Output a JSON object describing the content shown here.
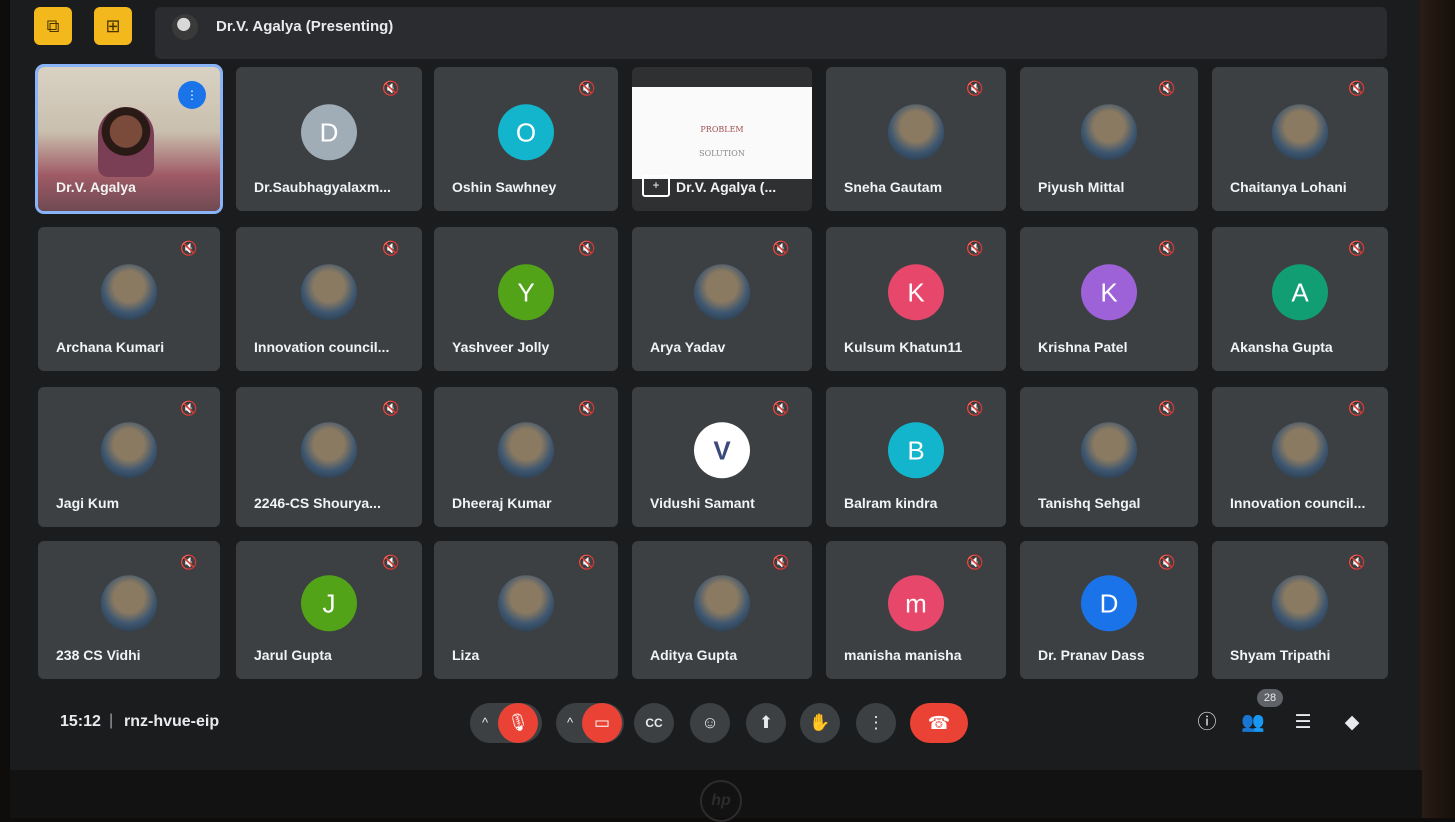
{
  "header": {
    "presenting_label": "Dr.V. Agalya (Presenting)",
    "buttons": [
      {
        "icon": "layout-icon",
        "glyph": "⧉"
      },
      {
        "icon": "pip-icon",
        "glyph": "⊞"
      }
    ]
  },
  "accent_colors": {
    "mic_off_red": "#ea4335",
    "speaking_blue": "#1a73e8",
    "tile_bg": "#3c4043"
  },
  "participants": [
    {
      "name": "Dr.V. Agalya",
      "type": "camera",
      "speaking": true
    },
    {
      "name": "Dr.Saubhagyalaxm...",
      "type": "initial",
      "initial": "D",
      "color": "#a0adb6"
    },
    {
      "name": "Oshin Sawhney",
      "type": "initial",
      "initial": "O",
      "color": "#12b5cb"
    },
    {
      "name": "Dr.V. Agalya (...",
      "type": "presentation",
      "slide_lines": [
        "PROBLEM",
        "SOLUTION"
      ]
    },
    {
      "name": "Sneha Gautam",
      "type": "photo"
    },
    {
      "name": "Piyush Mittal",
      "type": "photo"
    },
    {
      "name": "Chaitanya Lohani",
      "type": "photo"
    },
    {
      "name": "Archana Kumari",
      "type": "photo"
    },
    {
      "name": "Innovation council...",
      "type": "photo"
    },
    {
      "name": "Yashveer Jolly",
      "type": "initial",
      "initial": "Y",
      "color": "#53a318"
    },
    {
      "name": "Arya Yadav",
      "type": "photo"
    },
    {
      "name": "Kulsum Khatun11",
      "type": "initial",
      "initial": "K",
      "color": "#e6476a"
    },
    {
      "name": "Krishna Patel",
      "type": "initial",
      "initial": "K",
      "color": "#9d62d7"
    },
    {
      "name": "Akansha Gupta",
      "type": "initial",
      "initial": "A",
      "color": "#129e73"
    },
    {
      "name": "Jagi Kum",
      "type": "photo"
    },
    {
      "name": "2246-CS Shourya...",
      "type": "photo"
    },
    {
      "name": "Dheeraj Kumar",
      "type": "photo"
    },
    {
      "name": "Vidushi Samant",
      "type": "initial",
      "initial": "V",
      "color": "#ffffff"
    },
    {
      "name": "Balram kindra",
      "type": "initial",
      "initial": "B",
      "color": "#12b5cb"
    },
    {
      "name": "Tanishq Sehgal",
      "type": "photo"
    },
    {
      "name": "Innovation council...",
      "type": "photo"
    },
    {
      "name": "238 CS Vidhi",
      "type": "photo"
    },
    {
      "name": "Jarul Gupta",
      "type": "initial",
      "initial": "J",
      "color": "#53a318"
    },
    {
      "name": "Liza",
      "type": "photo"
    },
    {
      "name": "Aditya Gupta",
      "type": "photo"
    },
    {
      "name": "manisha manisha",
      "type": "initial",
      "initial": "m",
      "color": "#e6476a"
    },
    {
      "name": "Dr. Pranav Dass",
      "type": "initial",
      "initial": "D",
      "color": "#1a73e8"
    },
    {
      "name": "Shyam Tripathi",
      "type": "photo"
    }
  ],
  "footer": {
    "time": "15:12",
    "separator": "|",
    "meeting_code": "rnz-hvue-eip",
    "controls": [
      {
        "name": "mic-toggle",
        "icon": "mic-off-icon",
        "glyph": "🎙"
      },
      {
        "name": "camera-toggle",
        "icon": "camera-off-icon",
        "glyph": "▭"
      },
      {
        "name": "captions-button",
        "icon": "captions-icon",
        "glyph": "CC"
      },
      {
        "name": "reactions-button",
        "icon": "emoji-icon",
        "glyph": "☺"
      },
      {
        "name": "present-button",
        "icon": "present-icon",
        "glyph": "⬆"
      },
      {
        "name": "raise-hand-button",
        "icon": "hand-icon",
        "glyph": "✋"
      },
      {
        "name": "more-options-button",
        "icon": "more-vert-icon",
        "glyph": "⋮"
      }
    ],
    "hangup_glyph": "☎",
    "chevron_glyph": "^",
    "right_icons": [
      {
        "name": "info-button",
        "icon": "info-icon",
        "glyph": "ⓘ"
      },
      {
        "name": "people-button",
        "icon": "people-icon",
        "glyph": "👥"
      },
      {
        "name": "chat-button",
        "icon": "chat-icon",
        "glyph": "☰"
      },
      {
        "name": "activities-button",
        "icon": "activities-icon",
        "glyph": "◆"
      }
    ],
    "participant_count": "28"
  }
}
